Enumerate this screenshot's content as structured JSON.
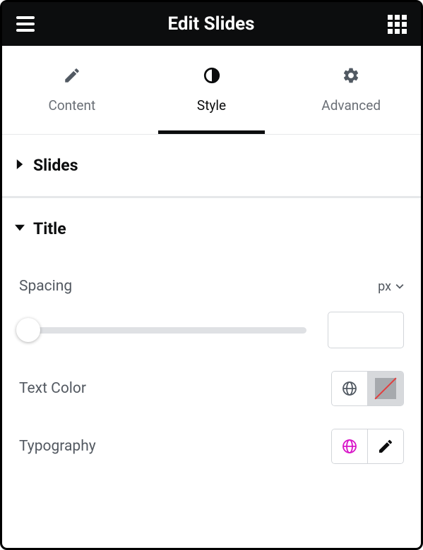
{
  "header": {
    "title": "Edit Slides"
  },
  "tabs": [
    {
      "label": "Content"
    },
    {
      "label": "Style"
    },
    {
      "label": "Advanced"
    }
  ],
  "sections": [
    {
      "label": "Slides",
      "expanded": false
    },
    {
      "label": "Title",
      "expanded": true
    }
  ],
  "title_controls": {
    "spacing": {
      "label": "Spacing",
      "unit": "px",
      "value": ""
    },
    "text_color": {
      "label": "Text Color"
    },
    "typography": {
      "label": "Typography"
    }
  }
}
